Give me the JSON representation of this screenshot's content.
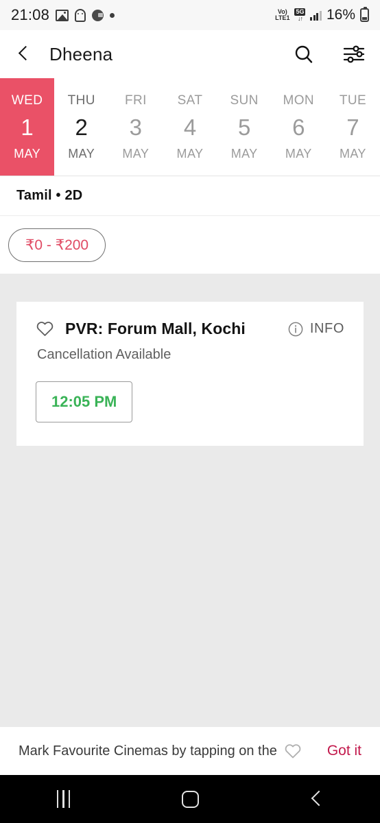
{
  "status_bar": {
    "time": "21:08",
    "notification_icons": [
      "photo-icon",
      "ghost-icon",
      "dark-circle-icon",
      "dot-icon"
    ],
    "volte_line1": "Vo)",
    "volte_line2": "LTE1",
    "network_badge": "5G",
    "network_arrows": "↓↑",
    "battery_percent": "16%"
  },
  "app_bar": {
    "back_icon": "back-chevron-icon",
    "title": "Dheena",
    "search_icon": "search-icon",
    "filter_icon": "filter-sliders-icon"
  },
  "dates": [
    {
      "dow": "WED",
      "day": "1",
      "month": "MAY",
      "state": "selected"
    },
    {
      "dow": "THU",
      "day": "2",
      "month": "MAY",
      "state": "near"
    },
    {
      "dow": "FRI",
      "day": "3",
      "month": "MAY",
      "state": "normal"
    },
    {
      "dow": "SAT",
      "day": "4",
      "month": "MAY",
      "state": "normal"
    },
    {
      "dow": "SUN",
      "day": "5",
      "month": "MAY",
      "state": "normal"
    },
    {
      "dow": "MON",
      "day": "6",
      "month": "MAY",
      "state": "normal"
    },
    {
      "dow": "TUE",
      "day": "7",
      "month": "MAY",
      "state": "normal"
    }
  ],
  "language_row": {
    "text": "Tamil  •  2D"
  },
  "filters": {
    "chips": [
      {
        "label": "₹0 - ₹200",
        "selected": false
      }
    ]
  },
  "cinemas": [
    {
      "favourite_icon": "heart-outline-icon",
      "name": "PVR: Forum Mall, Kochi",
      "info_icon": "info-circle-icon",
      "info_label": "INFO",
      "subtitle": "Cancellation Available",
      "showtimes": [
        "12:05 PM"
      ]
    }
  ],
  "banner": {
    "text": "Mark Favourite Cinemas by tapping on the",
    "heart_icon": "heart-outline-icon",
    "action_label": "Got it"
  },
  "nav_bar": {
    "recents_icon": "recents-icon",
    "home_icon": "home-icon",
    "back_icon": "back-icon"
  },
  "colors": {
    "accent_red": "#ea5167",
    "chip_text": "#e04a63",
    "showtime_green": "#3ab357",
    "got_it": "#c2184b",
    "page_bg": "#eaeaea"
  }
}
